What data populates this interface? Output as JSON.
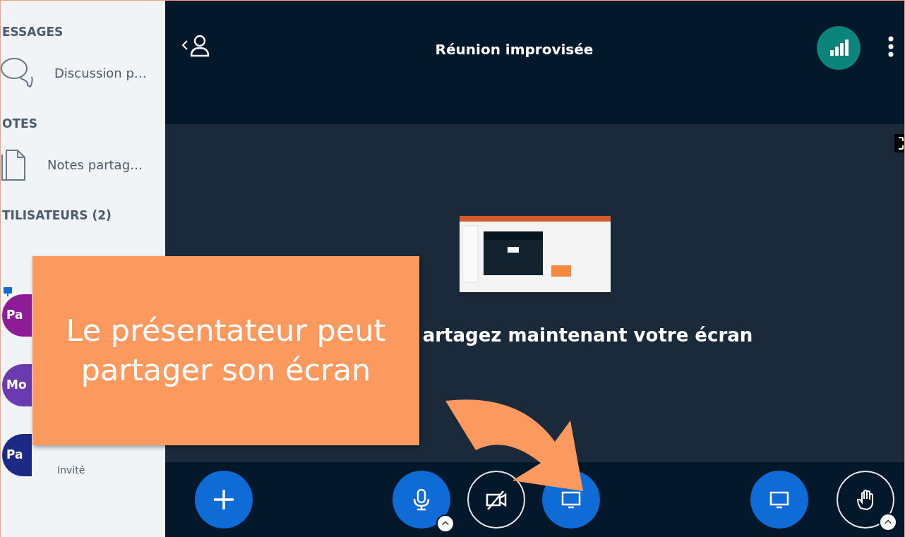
{
  "sidebar": {
    "sections": [
      {
        "heading": "ESSAGES",
        "items": [
          {
            "kind": "chat",
            "label": "Discussion p…"
          }
        ]
      },
      {
        "heading": "OTES",
        "items": [
          {
            "kind": "notes",
            "label": "Notes partag…"
          }
        ]
      },
      {
        "heading": "TILISATEURS (2)"
      }
    ],
    "users": [
      {
        "initials": "Pa",
        "color": "#8e1c98",
        "presenter": true
      },
      {
        "initials": "Mo",
        "color": "#6a3ab0",
        "presenter": false
      },
      {
        "initials": "Pa",
        "color": "#1c2a86",
        "presenter": false,
        "role": "Invité"
      }
    ]
  },
  "header": {
    "title": "Réunion improvisée"
  },
  "main": {
    "message": "artagez maintenant votre écran"
  },
  "toolbar": {
    "left": [
      {
        "kind": "plus",
        "on": true
      }
    ],
    "center": [
      {
        "kind": "mic",
        "on": true,
        "caret": true
      },
      {
        "kind": "camera",
        "on": false
      },
      {
        "kind": "screen",
        "on": true
      }
    ],
    "right": [
      {
        "kind": "screen",
        "on": true
      },
      {
        "kind": "hand",
        "on": false,
        "caret": true
      }
    ]
  },
  "callout": {
    "text": "Le présentateur peut partager son écran"
  }
}
